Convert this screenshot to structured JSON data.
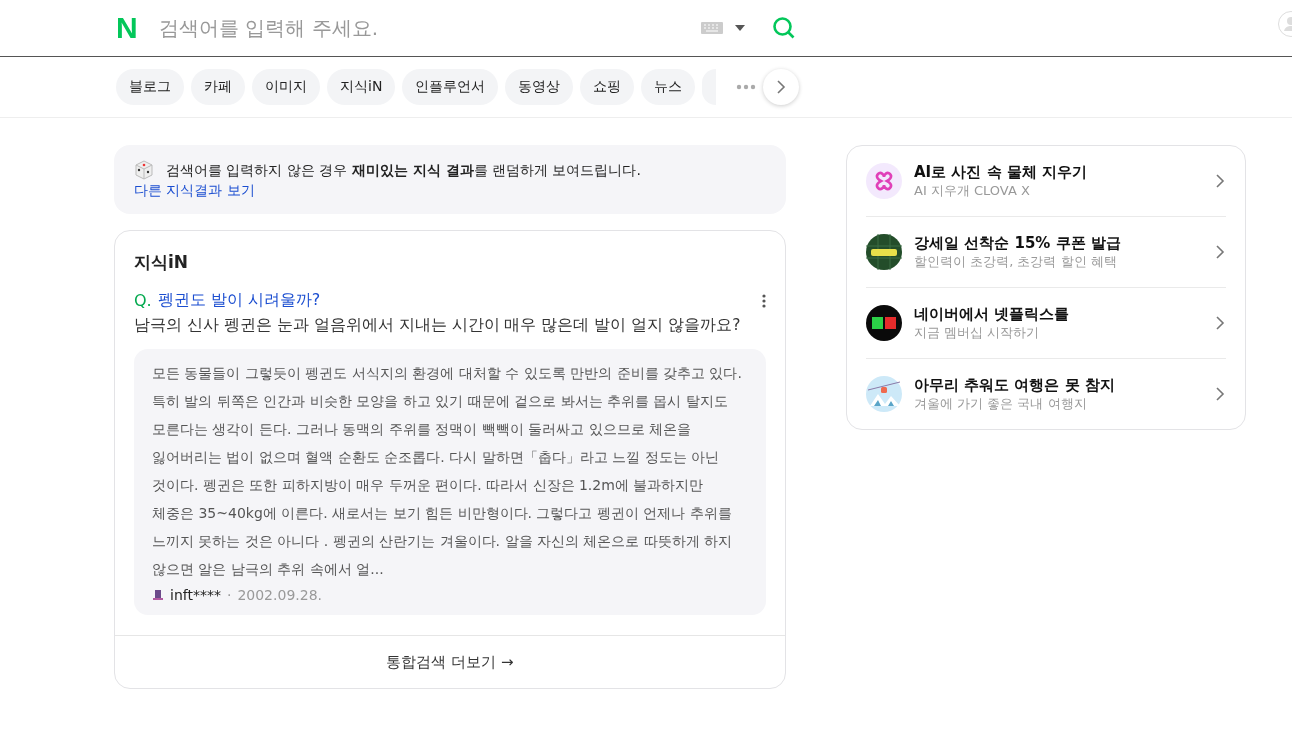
{
  "header": {
    "logo": "N",
    "search": {
      "placeholder": "검색어를 입력해 주세요."
    }
  },
  "chips": [
    {
      "label": "블로그",
      "selected": false
    },
    {
      "label": "카페",
      "selected": false
    },
    {
      "label": "이미지",
      "selected": false
    },
    {
      "label": "지식iN",
      "selected": false
    },
    {
      "label": "인플루언서",
      "selected": false
    },
    {
      "label": "동영상",
      "selected": false
    },
    {
      "label": "쇼핑",
      "selected": false
    },
    {
      "label": "뉴스",
      "selected": false
    }
  ],
  "notice": {
    "text": "검색어를 입력하지 않은 경우 **재미있는 지식 결과**를 랜덤하게 보여드립니다.",
    "link": "다른 지식결과 보기"
  },
  "kin": {
    "title": "지식iN",
    "question": "펭귄도 발이 시려울까?",
    "question_mark": "Q.",
    "question_detail": "남극의 신사 펭귄은 눈과 얼음위에서 지내는 시간이 매우 많은데 발이 얼지 않을까요?",
    "answer": "모든 동물들이 그렇듯이 펭귄도 서식지의 환경에 대처할 수 있도록 만반의 준비를 갖추고 있다. 특히 발의 뒤쪽은 인간과 비슷한 모양을 하고 있기 때문에 겉으로 봐서는 추위를 몹시 탈지도 모른다는 생각이 든다. 그러나 동맥의 주위를 정맥이 빽빽이 둘러싸고 있으므로 체온을 잃어버리는 법이 없으며 혈액 순환도 순조롭다. 다시 말하면「춥다」라고 느낄 정도는 아닌 것이다. 펭귄은 또한 피하지방이 매우 두꺼운 편이다. 따라서 신장은 1.2m에 불과하지만 체중은 35~40kg에 이른다. 새로서는 보기 힘든 비만형이다. 그렇다고 펭귄이 언제나 추위를 느끼지 못하는 것은 아니다 . 펭귄의 산란기는 겨울이다. 알을 자신의 체온으로 따뜻하게 하지 않으면 알은 남극의 추위 속에서 얼...",
    "author": "inft****",
    "separator": "·",
    "date": "2002.09.28.",
    "more": "통합검색 더보기 →"
  },
  "promos": [
    {
      "kind": "clova",
      "title": "AI로 사진 속 물체 지우기",
      "subtitle": "AI 지우개 CLOVA X"
    },
    {
      "kind": "sale",
      "title": "강세일 선착순 15% 쿠폰 발급",
      "subtitle": "할인력이 초강력, 초강력 할인 혜택"
    },
    {
      "kind": "netflix",
      "title": "네이버에서 넷플릭스를",
      "subtitle": "지금 멤버십 시작하기"
    },
    {
      "kind": "travel",
      "title": "아무리 추워도 여행은 못 참지",
      "subtitle": "겨울에 가기 좋은 국내 여행지"
    }
  ]
}
